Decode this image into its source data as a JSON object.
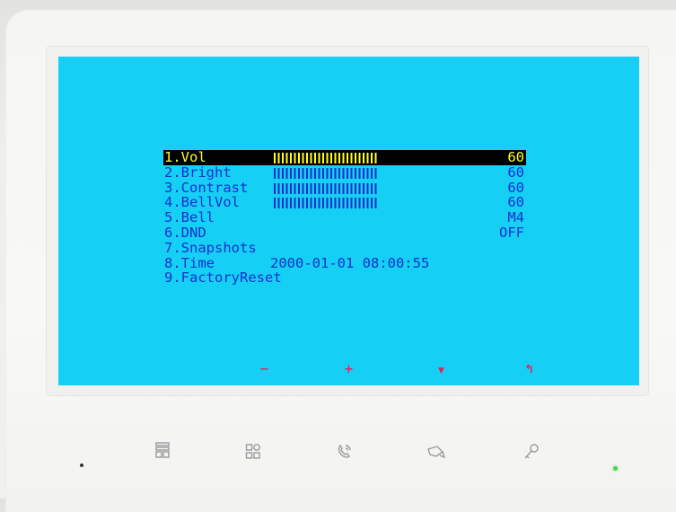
{
  "menu": {
    "items": [
      {
        "label": "1.Vol",
        "value": "60",
        "bar": true,
        "level": 0.6,
        "selected": true
      },
      {
        "label": "2.Bright",
        "value": "60",
        "bar": true,
        "level": 0.6,
        "selected": false
      },
      {
        "label": "3.Contrast",
        "value": "60",
        "bar": true,
        "level": 0.6,
        "selected": false
      },
      {
        "label": "4.BellVol",
        "value": "60",
        "bar": true,
        "level": 0.6,
        "selected": false
      },
      {
        "label": "5.Bell",
        "value": "M4",
        "bar": false,
        "selected": false
      },
      {
        "label": "6.DND",
        "value": "OFF",
        "bar": false,
        "selected": false
      },
      {
        "label": "7.Snapshots",
        "value": "",
        "bar": false,
        "selected": false
      },
      {
        "label": "8.Time",
        "value": "",
        "bar": false,
        "selected": false,
        "time": "2000-01-01 08:00:55"
      },
      {
        "label": "9.FactoryReset",
        "value": "",
        "bar": false,
        "selected": false
      }
    ]
  },
  "softkeys": {
    "minus": "−",
    "plus": "+",
    "down": "▼",
    "back": "↰"
  },
  "colors": {
    "screen_bg": "#15d0f4",
    "text": "#1530d0",
    "highlight_bg": "#000000",
    "highlight_text": "#ffff22",
    "softkey": "#e8205a",
    "led": "#4cd24c"
  },
  "hardware_buttons": [
    "menu-icon",
    "apps-icon",
    "phone-call-icon",
    "video-monitor-icon",
    "unlock-key-icon"
  ]
}
